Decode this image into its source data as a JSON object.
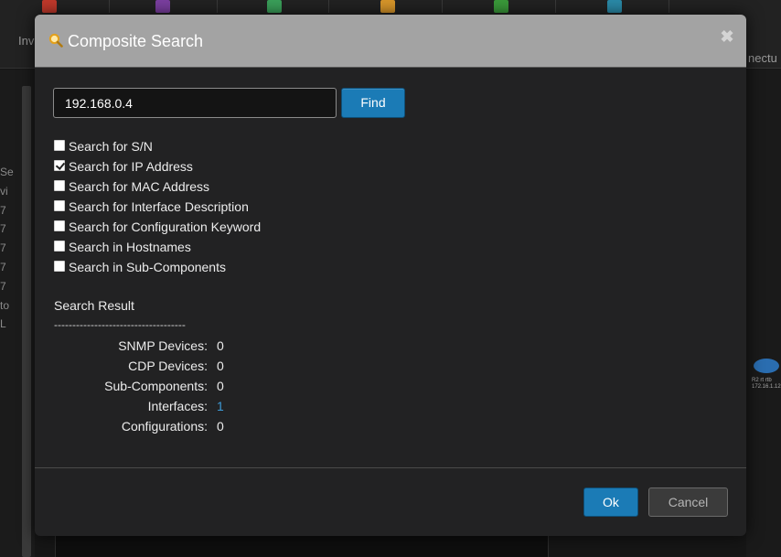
{
  "background": {
    "toolbar_label_left": "Inv",
    "toolbar_label_right": "nectu",
    "side_chars": [
      "Se",
      "vi",
      "7",
      "7",
      "7",
      "7",
      "7",
      "to",
      "L"
    ],
    "router_label_1": "R2 rt rtb",
    "router_label_2": "172.16.1.12"
  },
  "dialog": {
    "title": "Composite Search",
    "title_icon": "magnifier-icon",
    "close_glyph": "✖",
    "search": {
      "value": "192.168.0.4",
      "find_label": "Find"
    },
    "options": [
      {
        "label": "Search for S/N",
        "checked": false
      },
      {
        "label": "Search for IP Address",
        "checked": true
      },
      {
        "label": "Search for MAC Address",
        "checked": false
      },
      {
        "label": "Search for Interface Description",
        "checked": false
      },
      {
        "label": "Search for Configuration Keyword",
        "checked": false
      },
      {
        "label": "Search in Hostnames",
        "checked": false
      },
      {
        "label": "Search in Sub-Components",
        "checked": false
      }
    ],
    "result": {
      "title": "Search Result",
      "divider": "------------------------------------",
      "rows": [
        {
          "label": "SNMP Devices:",
          "value": "0"
        },
        {
          "label": "CDP Devices:",
          "value": "0"
        },
        {
          "label": "Sub-Components:",
          "value": "0"
        },
        {
          "label": "Interfaces:",
          "value": "1"
        },
        {
          "label": "Configurations:",
          "value": "0"
        }
      ]
    },
    "ok_label": "Ok",
    "cancel_label": "Cancel"
  },
  "colors": {
    "accent": "#1b7bb6",
    "header": "#a3a3a3",
    "link": "#3d9ad6"
  }
}
